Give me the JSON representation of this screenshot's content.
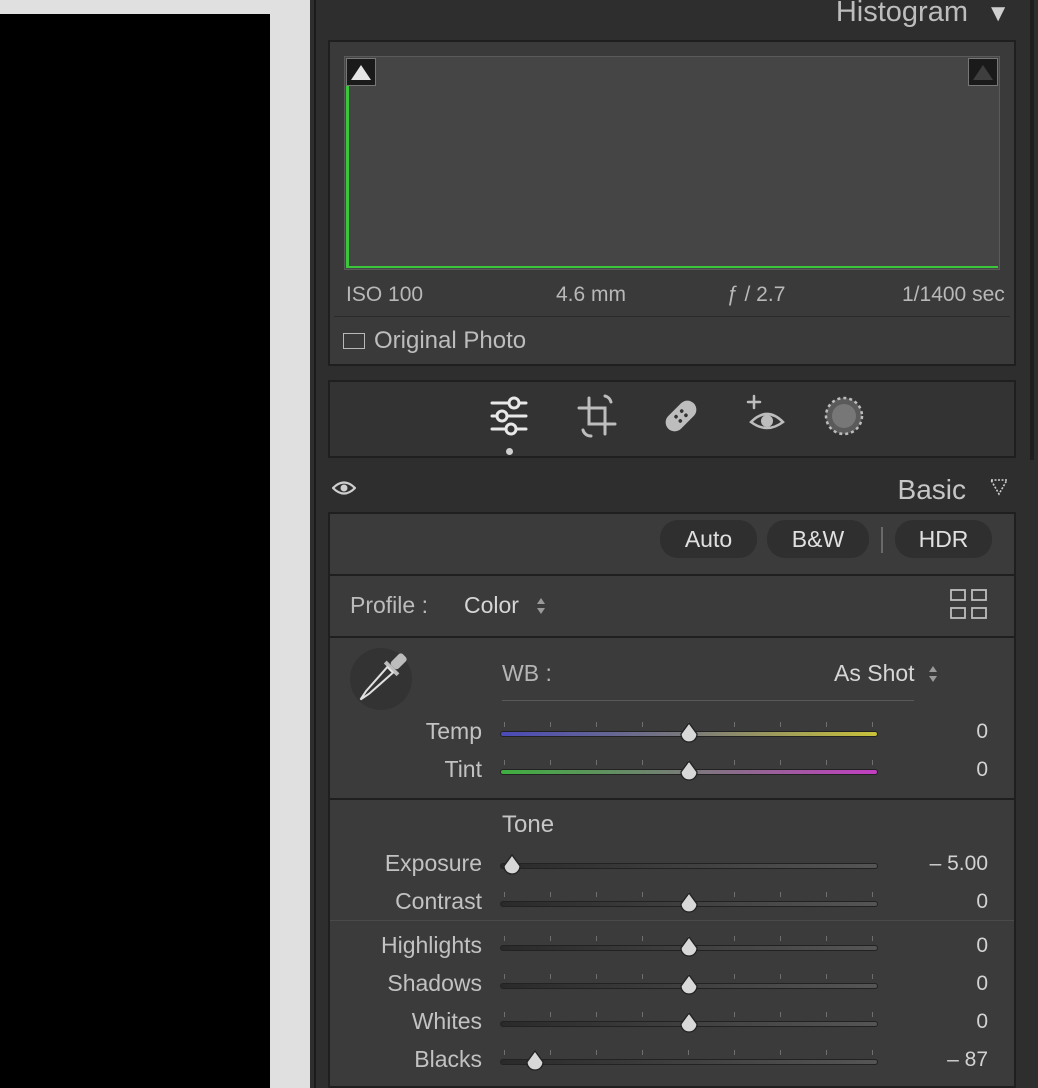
{
  "histogram": {
    "title": "Histogram",
    "collapse_glyph": "▼",
    "iso": "ISO 100",
    "focal_length": "4.6 mm",
    "aperture": "ƒ / 2.7",
    "shutter": "1/1400 sec",
    "original_photo_label": "Original Photo",
    "original_photo_checked": false,
    "clip_line_color": "#3cc63c"
  },
  "tools": [
    "edit-sliders-icon",
    "crop-icon",
    "healing-bandage-icon",
    "red-eye-icon",
    "masking-icon"
  ],
  "basic": {
    "title": "Basic",
    "buttons": {
      "auto": "Auto",
      "bw": "B&W",
      "hdr": "HDR"
    },
    "profile_label": "Profile :",
    "profile_value": "Color",
    "wb_label": "WB :",
    "wb_value": "As Shot",
    "tone_label": "Tone",
    "sliders": {
      "temp": {
        "label": "Temp",
        "value": "0",
        "level": 0.5
      },
      "tint": {
        "label": "Tint",
        "value": "0",
        "level": 0.5
      },
      "exposure": {
        "label": "Exposure",
        "value": "– 5.00",
        "level": 0.0
      },
      "contrast": {
        "label": "Contrast",
        "value": "0",
        "level": 0.5
      },
      "highlights": {
        "label": "Highlights",
        "value": "0",
        "level": 0.5
      },
      "shadows": {
        "label": "Shadows",
        "value": "0",
        "level": 0.5
      },
      "whites": {
        "label": "Whites",
        "value": "0",
        "level": 0.5
      },
      "blacks": {
        "label": "Blacks",
        "value": "– 87",
        "level": 0.065
      }
    }
  }
}
